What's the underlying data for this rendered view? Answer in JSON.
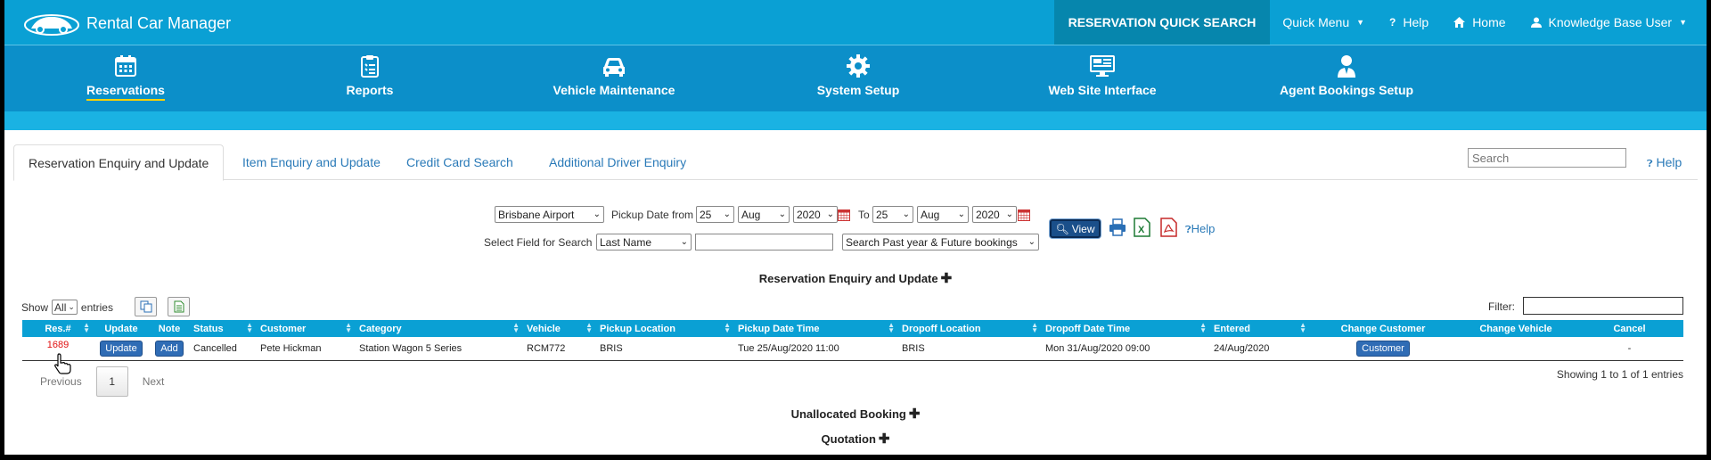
{
  "app": {
    "title": "Rental Car Manager",
    "colors": {
      "topbar": "#0aa0d4",
      "mainnav": "#0c8fc9",
      "accent_underline": "#ffd200",
      "link": "#2a7ab8",
      "res_no": "#e01010"
    }
  },
  "topnav": {
    "quick_search": "RESERVATION QUICK SEARCH",
    "quick_menu": "Quick Menu",
    "help": "Help",
    "home": "Home",
    "user": "Knowledge Base User"
  },
  "mainnav": [
    {
      "label": "Reservations",
      "icon": "calendar-icon"
    },
    {
      "label": "Reports",
      "icon": "clipboard-icon"
    },
    {
      "label": "Vehicle Maintenance",
      "icon": "car-icon"
    },
    {
      "label": "System Setup",
      "icon": "gear-icon"
    },
    {
      "label": "Web Site Interface",
      "icon": "monitor-icon"
    },
    {
      "label": "Agent Bookings Setup",
      "icon": "agent-icon"
    }
  ],
  "tabs": [
    "Reservation Enquiry and Update",
    "Item Enquiry and Update",
    "Credit Card Search",
    "Additional Driver Enquiry"
  ],
  "search": {
    "placeholder": "Search",
    "help": "Help"
  },
  "filters": {
    "location": "Brisbane Airport",
    "pickup_from_label": "Pickup Date from",
    "from_day": "25",
    "from_month": "Aug",
    "from_year": "2020",
    "to_label": "To",
    "to_day": "25",
    "to_month": "Aug",
    "to_year": "2020",
    "field_label": "Select Field for Search",
    "field": "Last Name",
    "scope": "Search Past year & Future bookings",
    "view": "View",
    "help": "Help"
  },
  "section_main": "Reservation Enquiry and Update",
  "table_controls": {
    "show": "Show",
    "entries_value": "All",
    "entries": "entries",
    "filter": "Filter:"
  },
  "table": {
    "headers": [
      "Res.#",
      "Update",
      "Note",
      "Status",
      "Customer",
      "Category",
      "Vehicle",
      "Pickup Location",
      "Pickup Date Time",
      "Dropoff Location",
      "Dropoff Date Time",
      "Entered",
      "Change Customer",
      "Change Vehicle",
      "Cancel"
    ],
    "rows": [
      {
        "res": "1689",
        "update": "Update",
        "note": "Add",
        "status": "Cancelled",
        "customer": "Pete Hickman",
        "category": "Station Wagon 5 Series",
        "vehicle": "RCM772",
        "pickup_location": "BRIS",
        "pickup_dt": "Tue 25/Aug/2020 11:00",
        "dropoff_location": "BRIS",
        "dropoff_dt": "Mon 31/Aug/2020 09:00",
        "entered": "24/Aug/2020",
        "change_customer": "Customer",
        "change_vehicle": "",
        "cancel": "-"
      }
    ]
  },
  "pager": {
    "previous": "Previous",
    "page": "1",
    "next": "Next",
    "showing": "Showing 1 to 1 of 1 entries"
  },
  "sections": {
    "unallocated": "Unallocated Booking",
    "quotation": "Quotation",
    "plus": "✚"
  }
}
